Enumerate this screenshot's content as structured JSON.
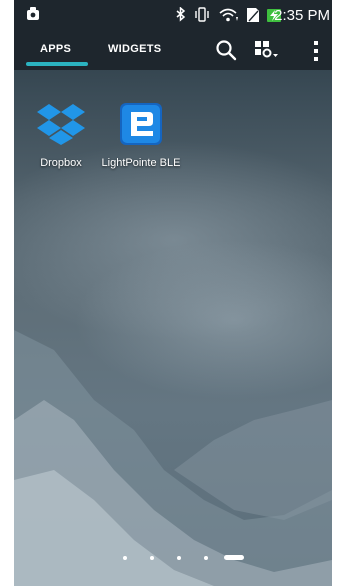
{
  "status_bar": {
    "time": "2:35 PM",
    "icons": [
      "notification-icon",
      "bluetooth-icon",
      "vibrate-icon",
      "wifi-icon",
      "sim-icon",
      "battery-charging-icon"
    ]
  },
  "top_bar": {
    "tabs": [
      {
        "label": "APPS",
        "active": true
      },
      {
        "label": "WIDGETS",
        "active": false
      }
    ],
    "accent_color": "#2bb3c0",
    "actions": [
      "search-icon",
      "grid-settings-icon",
      "overflow-menu-icon"
    ]
  },
  "apps": [
    {
      "label": "Dropbox",
      "icon": "dropbox-icon",
      "color": "#2196e8"
    },
    {
      "label": "LightPointe BLE",
      "icon": "lightpointe-icon",
      "color": "#1976d2"
    }
  ],
  "page_indicator": {
    "pages": 5,
    "current": 5
  }
}
